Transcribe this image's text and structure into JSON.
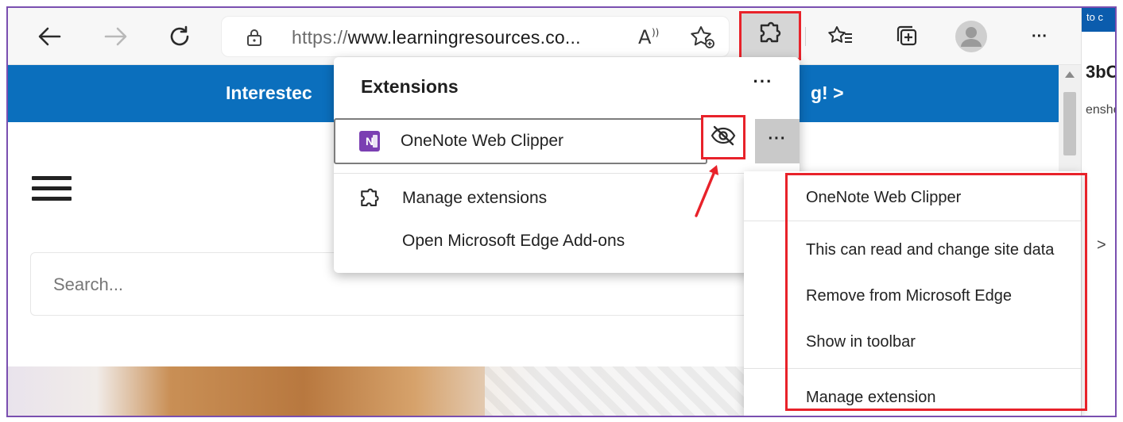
{
  "toolbar": {
    "url_scheme": "https://",
    "url_host": "www.learningresources.co...",
    "back_icon": "back-arrow-icon",
    "forward_icon": "forward-arrow-icon",
    "refresh_icon": "refresh-icon",
    "lock_icon": "lock-icon",
    "read_aloud_icon": "read-aloud-icon",
    "favorite_icon": "add-favorite-icon",
    "extensions_icon": "puzzle-icon",
    "favorites_icon": "favorites-icon",
    "collections_icon": "collections-icon",
    "profile_icon": "profile-icon",
    "more_label": "···"
  },
  "page": {
    "banner_left": "Interestec",
    "banner_right": "g! >",
    "search_placeholder": "Search..."
  },
  "sliver": {
    "top_text": "to c",
    "heading": "3bC",
    "sub": "ensho"
  },
  "extensions_panel": {
    "title": "Extensions",
    "more_label": "···",
    "items": [
      {
        "label": "OneNote Web Clipper",
        "icon": "onenote-icon"
      }
    ],
    "hide_icon": "eye-slash-icon",
    "item_more_label": "···",
    "manage_label": "Manage extensions",
    "addons_label": "Open Microsoft Edge Add-ons"
  },
  "context_menu": {
    "items": [
      "OneNote Web Clipper",
      "This can read and change site data",
      "Remove from Microsoft Edge",
      "Show in toolbar",
      "Manage extension"
    ],
    "chevron": ">"
  },
  "colors": {
    "highlight_red": "#e8222a",
    "banner_blue": "#0b6fbd",
    "onenote_purple": "#7b3fb2",
    "frame_purple": "#7a4fb0"
  }
}
